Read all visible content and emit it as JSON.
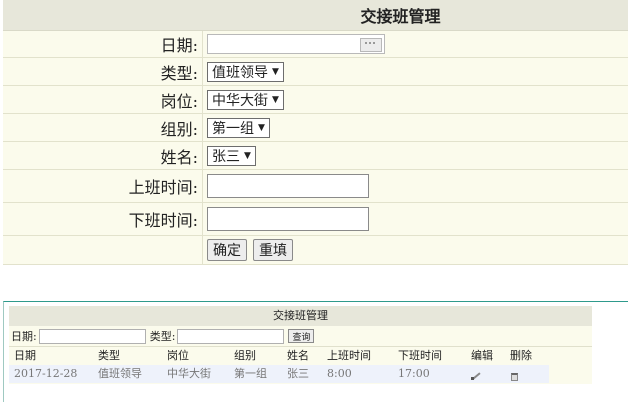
{
  "form": {
    "title": "交接班管理",
    "fields": [
      {
        "label": "日期:",
        "type": "date",
        "value": ""
      },
      {
        "label": "类型:",
        "type": "select",
        "value": "值班领导"
      },
      {
        "label": "岗位:",
        "type": "select",
        "value": "中华大街"
      },
      {
        "label": "组别:",
        "type": "select",
        "value": "第一组"
      },
      {
        "label": "姓名:",
        "type": "select",
        "value": "张三"
      },
      {
        "label": "上班时间:",
        "type": "text",
        "value": ""
      },
      {
        "label": "下班时间:",
        "type": "text",
        "value": ""
      }
    ],
    "submit_label": "确定",
    "reset_label": "重填",
    "select_arrow": "▼"
  },
  "list": {
    "title": "交接班管理",
    "search": {
      "date_label": "日期:",
      "type_label": "类型:",
      "query_label": "查询"
    },
    "columns": [
      "日期",
      "类型",
      "岗位",
      "组别",
      "姓名",
      "上班时间",
      "下班时间",
      "编辑",
      "删除"
    ],
    "rows": [
      {
        "date": "2017-12-28",
        "type": "值班领导",
        "post": "中华大街",
        "group": "第一组",
        "name": "张三",
        "start": "8:00",
        "end": "17:00",
        "edit_icon": "edit-icon",
        "delete_icon": "trash-icon"
      }
    ]
  }
}
